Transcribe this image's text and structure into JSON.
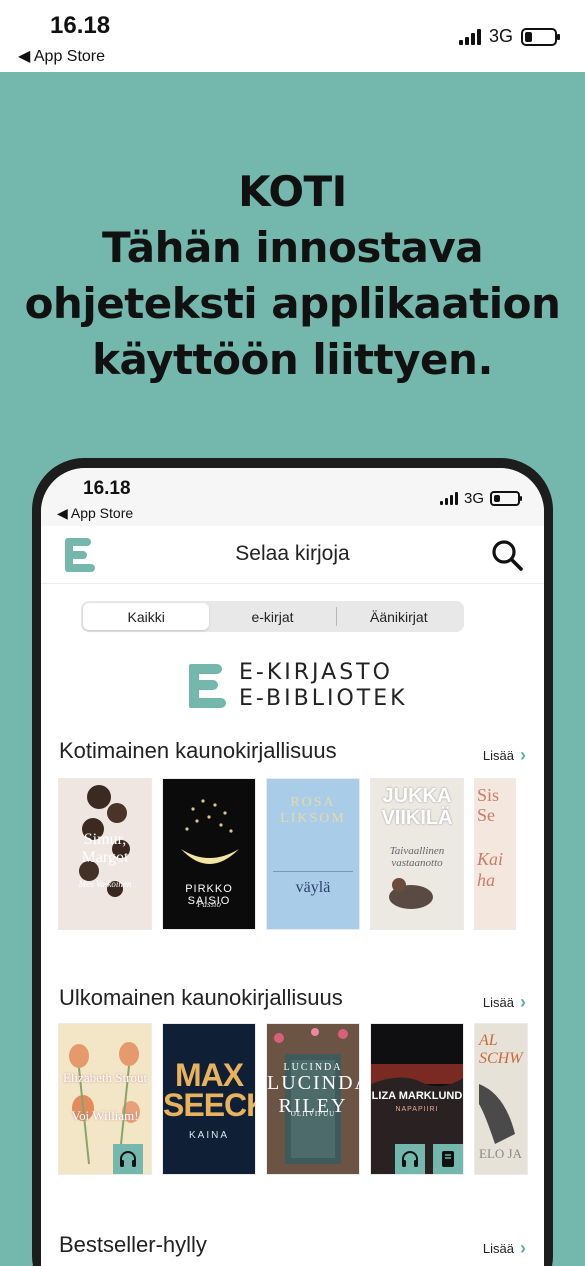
{
  "status": {
    "time": "16.18",
    "back": "◀ App Store",
    "network": "3G"
  },
  "headline": {
    "line1": "KOTI",
    "line2": "Tähän innostava",
    "line3": "ohjeteksti applikaation",
    "line4": "käyttöön liittyen."
  },
  "inner_status": {
    "time": "16.18",
    "back": "◀ App Store",
    "network": "3G"
  },
  "appbar": {
    "title": "Selaa kirjoja"
  },
  "segments": [
    {
      "label": "Kaikki",
      "active": true
    },
    {
      "label": "e-kirjat",
      "active": false
    },
    {
      "label": "Äänikirjat",
      "active": false
    }
  ],
  "brand": {
    "line1": "E-KIRJASTO",
    "line2": "E-BIBLIOTEK"
  },
  "sections": [
    {
      "title": "Kotimainen kaunokirjallisuus",
      "more": "Lisää",
      "books": [
        {
          "author": "Simur, Margot",
          "title": "Mes Valkoinen"
        },
        {
          "author": "PIRKKO SAISIO",
          "title": "Passio"
        },
        {
          "author": "ROSA LIKSOM",
          "title": "väylä"
        },
        {
          "author": "JUKKA VIIKILÄ",
          "title": "Taivaallinen vastaanotto"
        },
        {
          "author": "Sis Se",
          "title": "Kai ha"
        }
      ]
    },
    {
      "title": "Ulkomainen kaunokirjallisuus",
      "more": "Lisää",
      "books": [
        {
          "author": "Elizabeth Strout",
          "title": "Voi William!",
          "badges": [
            "headphones-icon"
          ]
        },
        {
          "author": "MAX SEECK",
          "title": "KAINA",
          "badges": []
        },
        {
          "author": "LUCINDA RILEY",
          "title": "OLIIVIPUU",
          "badges": []
        },
        {
          "author": "LIZA MARKLUND",
          "title": "NAPAPIIRI",
          "badges": [
            "headphones-icon",
            "book-icon"
          ]
        },
        {
          "author": "AL SCHW",
          "title": "ELO JA",
          "badges": []
        }
      ]
    },
    {
      "title": "Bestseller-hylly",
      "more": "Lisää"
    }
  ],
  "colors": {
    "accent": "#74b8ad",
    "background": "#74b8ad"
  }
}
